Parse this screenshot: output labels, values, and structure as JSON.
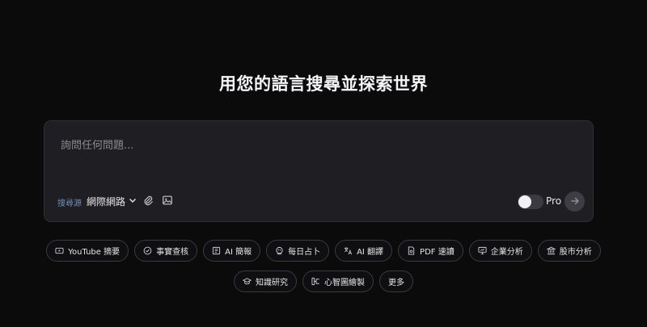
{
  "headline": "用您的語言搜尋並探索世界",
  "search": {
    "placeholder": "詢問任何問題...",
    "source_label": "搜尋源",
    "source_value": "網際網路",
    "pro_label": "Pro",
    "pro_enabled": false
  },
  "chips_row1": [
    {
      "label": "YouTube 摘要",
      "icon": "youtube-icon"
    },
    {
      "label": "事實查核",
      "icon": "check-circle-icon"
    },
    {
      "label": "AI 簡報",
      "icon": "slides-icon"
    },
    {
      "label": "每日占卜",
      "icon": "fortune-icon"
    },
    {
      "label": "AI 翻譯",
      "icon": "translate-icon"
    },
    {
      "label": "PDF 速讀",
      "icon": "pdf-icon"
    },
    {
      "label": "企業分析",
      "icon": "presentation-icon"
    },
    {
      "label": "股市分析",
      "icon": "bank-icon"
    }
  ],
  "chips_row2": [
    {
      "label": "知識研究",
      "icon": "graduation-cap-icon"
    },
    {
      "label": "心智圖繪製",
      "icon": "mindmap-icon"
    },
    {
      "label": "更多",
      "icon": ""
    }
  ]
}
